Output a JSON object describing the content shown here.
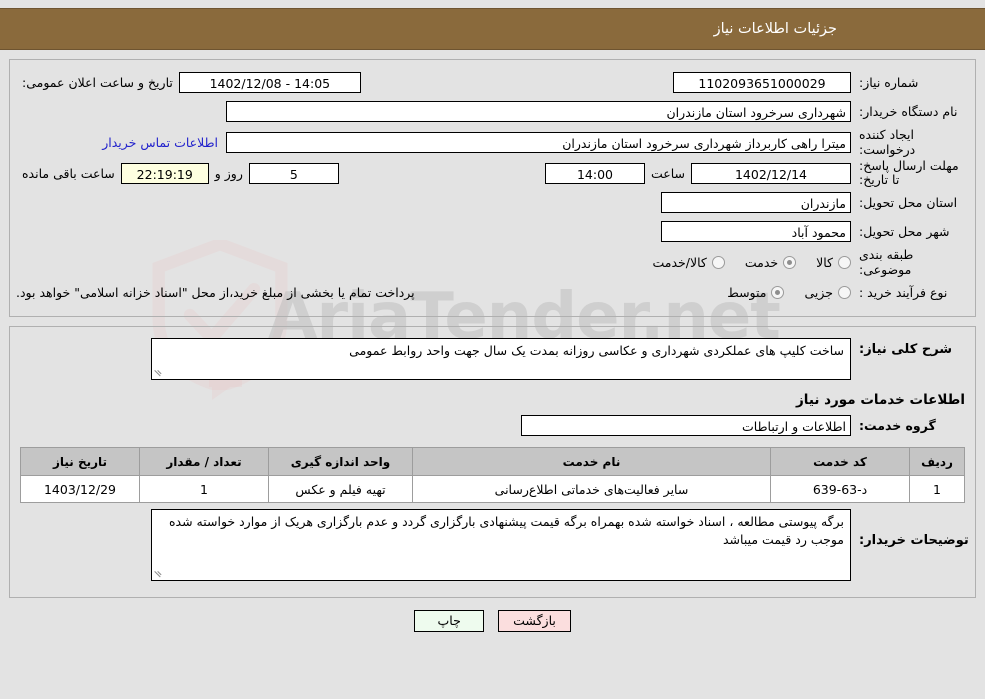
{
  "header": {
    "title": "جزئیات اطلاعات نیاز"
  },
  "form": {
    "need_number_label": "شماره نیاز:",
    "need_number_value": "1102093651000029",
    "public_announce_label": "تاریخ و ساعت اعلان عمومی:",
    "public_announce_value": "14:05 - 1402/12/08",
    "buyer_org_label": "نام دستگاه خریدار:",
    "buyer_org_value": "شهرداری سرخرود استان مازندران",
    "creator_label": "ایجاد کننده درخواست:",
    "creator_value": "میترا راهی کاربرداز شهرداری سرخرود استان مازندران",
    "contact_link": "اطلاعات تماس خریدار",
    "deadline_label": "مهلت ارسال پاسخ: تا تاریخ:",
    "deadline_date": "1402/12/14",
    "deadline_hour_label": "ساعت",
    "deadline_hour": "14:00",
    "remaining_days": "5",
    "remaining_days_label": "روز و",
    "remaining_clock": "22:19:19",
    "remaining_suffix": "ساعت باقی مانده",
    "province_label": "استان محل تحویل:",
    "province_value": "مازندران",
    "city_label": "شهر محل تحویل:",
    "city_value": "محمود آباد",
    "category_label": "طبقه بندی موضوعی:",
    "category_options": [
      {
        "label": "کالا",
        "selected": false
      },
      {
        "label": "خدمت",
        "selected": true
      },
      {
        "label": "کالا/خدمت",
        "selected": false
      }
    ],
    "purchase_type_label": "نوع فرآیند خرید :",
    "purchase_type_options": [
      {
        "label": "جزیی",
        "selected": false
      },
      {
        "label": "متوسط",
        "selected": true
      }
    ],
    "payment_note": "پرداخت تمام یا بخشی از مبلغ خرید،از محل \"اسناد خزانه اسلامی\" خواهد بود."
  },
  "description": {
    "label": "شرح کلی نیاز:",
    "value": "ساخت کلیپ های عملکردی شهرداری و عکاسی روزانه بمدت یک سال جهت واحد روابط عمومی"
  },
  "services": {
    "section_title": "اطلاعات خدمات مورد نیاز",
    "group_label": "گروه خدمت:",
    "group_value": "اطلاعات و ارتباطات",
    "table": {
      "columns": [
        "ردیف",
        "کد خدمت",
        "نام خدمت",
        "واحد اندازه گیری",
        "تعداد / مقدار",
        "تاریخ نیاز"
      ],
      "rows": [
        {
          "row": "1",
          "code": "د-63-639",
          "name": "سایر فعالیت‌های خدماتی اطلاع‌رسانی",
          "unit": "تهیه فیلم و عکس",
          "quantity": "1",
          "need_date": "1403/12/29"
        }
      ]
    }
  },
  "remarks": {
    "label": "توضیحات خریدار:",
    "value": "برگه پیوستی مطالعه ، اسناد خواسته شده بهمراه برگه قیمت پیشنهادی بارگزاری گردد و عدم بارگزاری هریک از موارد خواسته شده موجب رد قیمت میباشد"
  },
  "footer": {
    "print_label": "چاپ",
    "back_label": "بازگشت"
  },
  "watermark": {
    "text": "AriaTender.net"
  },
  "colors": {
    "header_bg": "#8a6a3c",
    "page_bg": "#e3e3e3",
    "link": "#2222cc",
    "table_header_bg": "#c5c5c5",
    "print_btn_bg": "#eefbee",
    "back_btn_bg": "#fbdede",
    "timer_bg": "#feffe0"
  }
}
